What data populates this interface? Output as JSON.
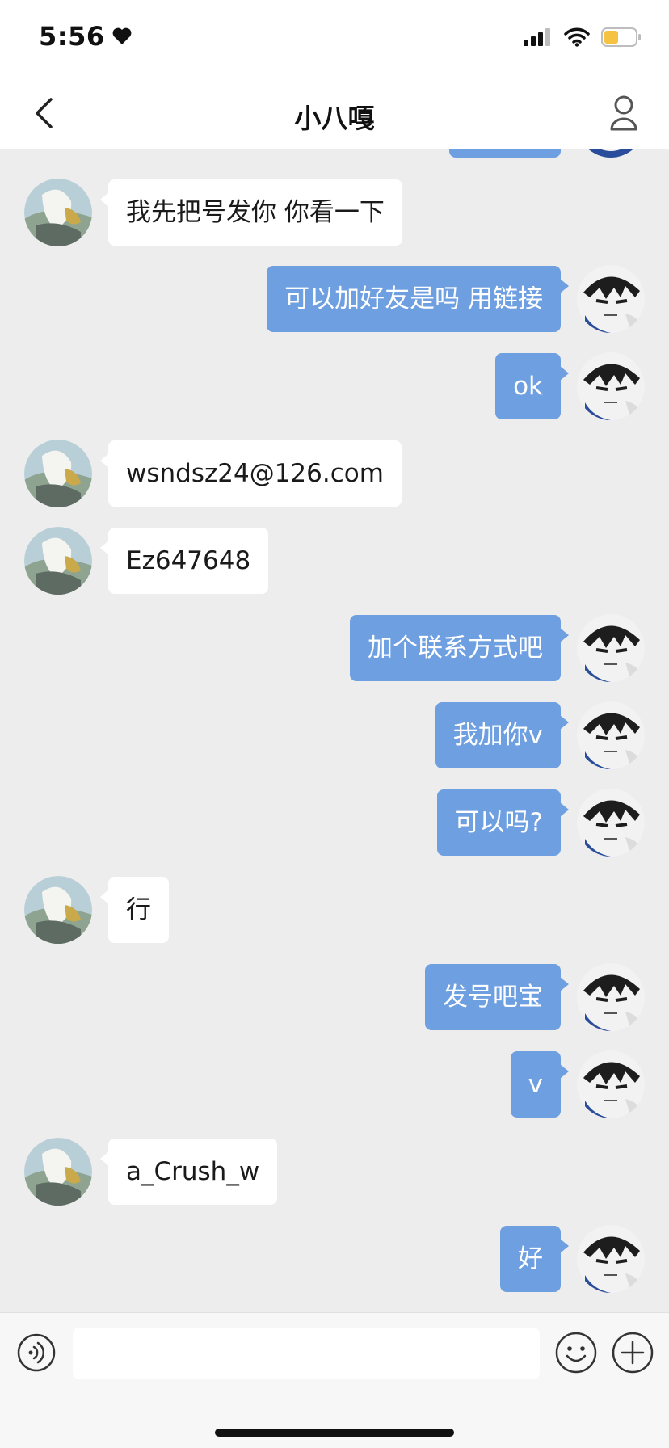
{
  "status_bar": {
    "time": "5:56",
    "icons": [
      "heart-icon",
      "cellular-signal-icon",
      "wifi-icon",
      "battery-icon"
    ],
    "battery_color": "#f5c242"
  },
  "nav": {
    "title": "小八嘎",
    "back_icon": "chevron-left-icon",
    "profile_icon": "person-icon"
  },
  "chat": {
    "colors": {
      "background": "#ededed",
      "outgoing_bubble": "#6e9fe1",
      "incoming_bubble": "#ffffff"
    },
    "messages": [
      {
        "side": "incoming",
        "text": "我先把号发你 你看一下"
      },
      {
        "side": "outgoing",
        "text": "可以加好友是吗 用链接"
      },
      {
        "side": "outgoing",
        "text": "ok"
      },
      {
        "side": "incoming",
        "text": "wsndsz24@126.com"
      },
      {
        "side": "incoming",
        "text": "Ez647648"
      },
      {
        "side": "outgoing",
        "text": "加个联系方式吧"
      },
      {
        "side": "outgoing",
        "text": "我加你v"
      },
      {
        "side": "outgoing",
        "text": "可以吗?"
      },
      {
        "side": "incoming",
        "text": "行"
      },
      {
        "side": "outgoing",
        "text": "发号吧宝"
      },
      {
        "side": "outgoing",
        "text": "v"
      },
      {
        "side": "incoming",
        "text": "a_Crush_w"
      },
      {
        "side": "outgoing",
        "text": "好"
      }
    ]
  },
  "input_bar": {
    "value": "",
    "voice_icon": "voice-icon",
    "emoji_icon": "emoji-icon",
    "plus_icon": "plus-icon"
  }
}
